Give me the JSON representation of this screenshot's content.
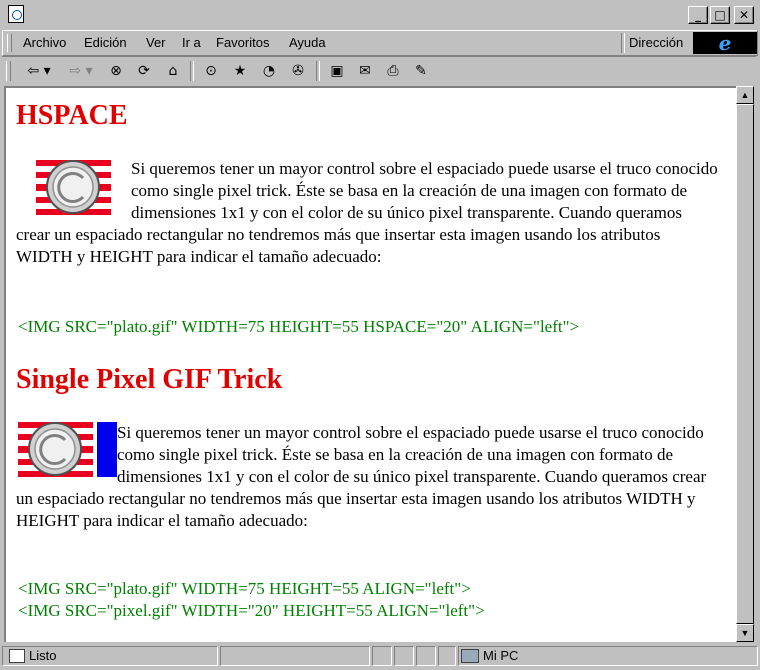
{
  "menu": {
    "items": [
      "Archivo",
      "Edición",
      "Ver",
      "Ir a",
      "Favoritos",
      "Ayuda"
    ],
    "address_label": "Dirección"
  },
  "toolbar": {
    "icons": [
      "back-icon",
      "forward-icon",
      "stop-icon",
      "refresh-icon",
      "home-icon",
      "search-icon",
      "favorites-icon",
      "history-icon",
      "channels-icon",
      "fullscreen-icon",
      "mail-icon",
      "print-icon",
      "edit-icon"
    ]
  },
  "page": {
    "section1": {
      "title": "HSPACE",
      "body": "Si queremos tener un mayor control sobre el espaciado puede usarse el truco conocido como single pixel trick. Éste se basa en la creación de una imagen con formato de dimensiones 1x1 y con el color de su único pixel transparente. Cuando queramos crear un espaciado rectangular no tendremos más que insertar esta imagen usando los atributos WIDTH y HEIGHT para indicar el tamaño adecuado:",
      "code": "<IMG SRC=\"plato.gif\" WIDTH=75 HEIGHT=55 HSPACE=\"20\" ALIGN=\"left\">"
    },
    "section2": {
      "title": "Single Pixel GIF Trick",
      "body": "Si queremos tener un mayor control sobre el espaciado puede usarse el truco conocido como single pixel trick. Éste se basa en la creación de una imagen con formato de dimensiones 1x1 y con el color de su único pixel transparente. Cuando queramos crear un espaciado rectangular no tendremos más que insertar esta imagen usando los atributos WIDTH y HEIGHT para indicar el tamaño adecuado:",
      "code_line1": "<IMG SRC=\"plato.gif\" WIDTH=75 HEIGHT=55 ALIGN=\"left\">",
      "code_line2": "<IMG SRC=\"pixel.gif\" WIDTH=\"20\" HEIGHT=55 ALIGN=\"left\">"
    }
  },
  "status": {
    "text": "Listo",
    "zone": "Mi PC"
  },
  "colors": {
    "heading": "#e00000",
    "code": "#008000",
    "pixel": "#0000ee"
  }
}
